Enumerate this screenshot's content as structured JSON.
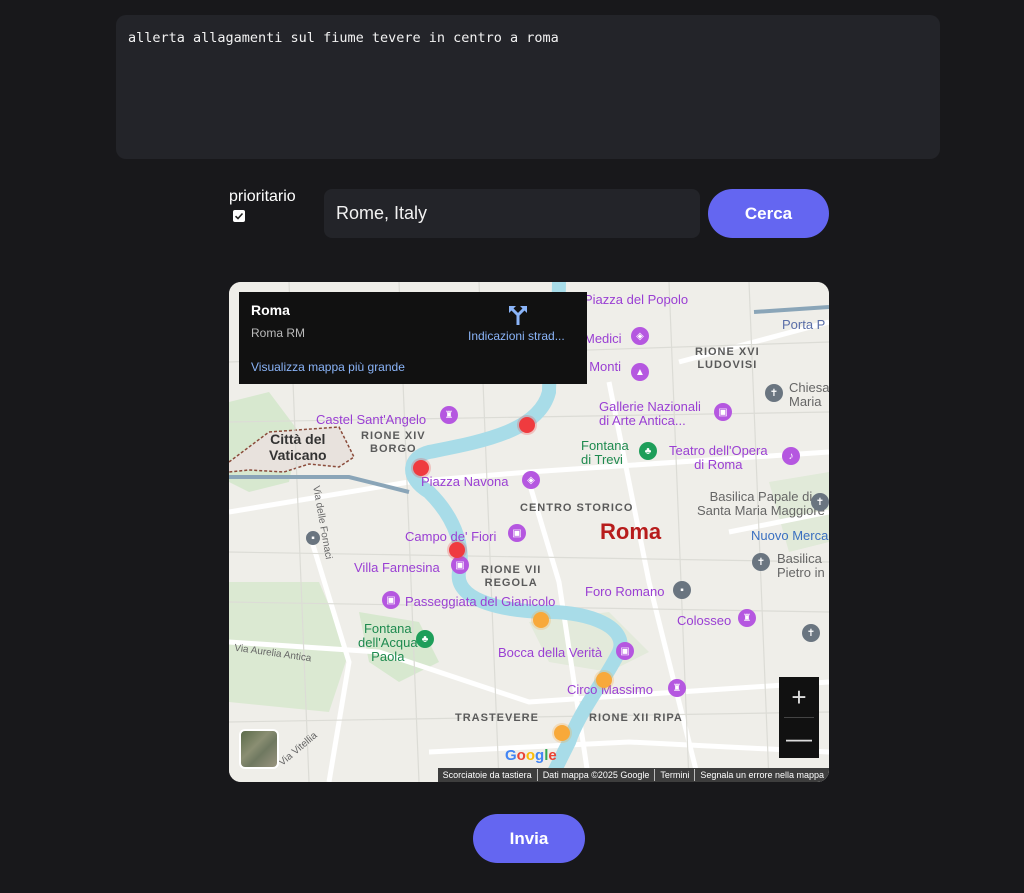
{
  "query": {
    "text": "allerta allagamenti sul fiume tevere in centro a roma"
  },
  "priority": {
    "label": "prioritario",
    "checked": true
  },
  "location": {
    "value": "Rome, Italy"
  },
  "buttons": {
    "search_label": "Cerca",
    "send_label": "Invia"
  },
  "colors": {
    "background": "#18181b",
    "input_bg": "#232429",
    "accent": "#6466f1",
    "marker_red": "#ef3b3f",
    "marker_orange": "#f8a93a"
  },
  "map": {
    "info_card": {
      "title": "Roma",
      "subtitle": "Roma RM",
      "larger_map_link": "Visualizza mappa più grande",
      "directions_label": "Indicazioni strad..."
    },
    "labels": {
      "piazza_del_popolo": "Piazza del Popolo",
      "porta_pia": "Porta P",
      "medici": "Medici",
      "trinita": "Trinità dei Monti",
      "rione_xvi": "RIONE XVI\nLUDOVISI",
      "chiesa_maria": "Chiesa\nMaria",
      "castel_santangelo": "Castel Sant'Angelo",
      "galleria": "Gallerie Nazionali\ndi Arte Antica...",
      "citta_vaticano": "Città del\nVaticano",
      "rione_xiv": "RIONE XIV\nBORGO",
      "fontana_trevi": "Fontana\ndi Trevi",
      "teatro_opera": "Teatro dell'Opera\ndi Roma",
      "piazza_navona": "Piazza Navona",
      "centro_storico": "CENTRO STORICO",
      "basilica_maggiore": "Basilica Papale di\nSanta Maria Maggiore",
      "roma": "Roma",
      "via_fornaci": "Via delle Fornaci",
      "campo_fiori": "Campo de' Fiori",
      "nuovo_merca": "Nuovo Merca",
      "villa_farnesina": "Villa Farnesina",
      "rione_vii": "RIONE VII\nREGOLA",
      "basilica_pietro": "Basilica\nPietro in",
      "passeggiata": "Passeggiata del Gianicolo",
      "foro_romano": "Foro Romano",
      "colosseo": "Colosseo",
      "fontana_acqua": "Fontana\ndell'Acqua\nPaola",
      "via_aurelia": "Via Aurelia Antica",
      "bocca_verita": "Bocca della Verità",
      "circo_massimo": "Circo Massimo",
      "trastevere": "TRASTEVERE",
      "rione_xii": "RIONE XII RIPA",
      "via_vitellia": "Via Vitellia"
    },
    "google_logo": "Google",
    "attribution": [
      "Scorciatoie da tastiera",
      "Dati mappa ©2025 Google",
      "Termini",
      "Segnala un errore nella mappa"
    ],
    "zoom_in": "+",
    "zoom_out": "—"
  }
}
